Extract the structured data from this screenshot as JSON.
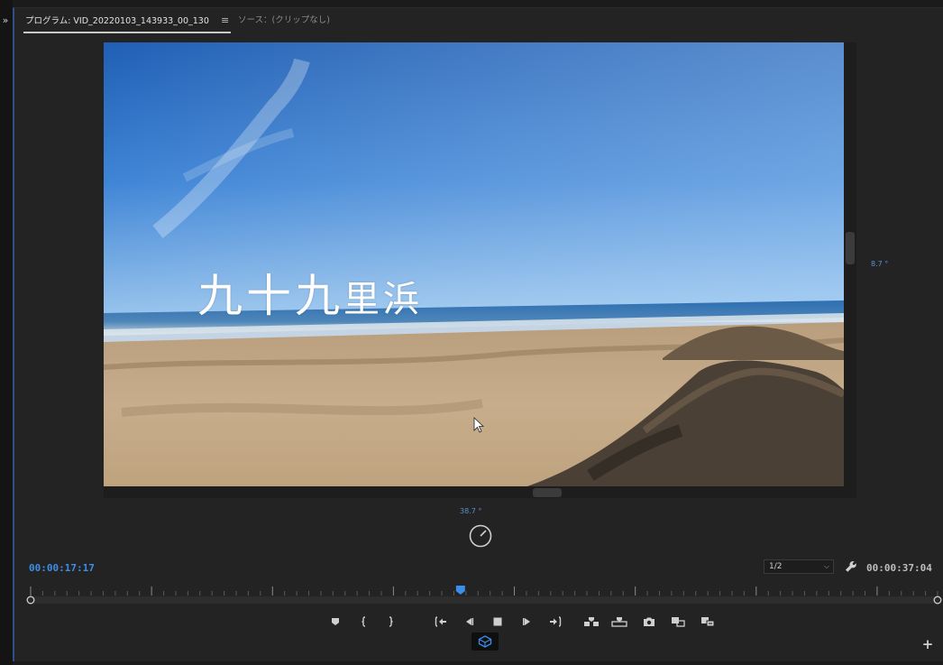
{
  "tabs": {
    "program_label": "プログラム: VID_20220103_143933_00_130",
    "menu_icon": "hamburger-menu-icon",
    "source_label": "ソース：(クリップなし)"
  },
  "monitor": {
    "overlay_title_large": "九十九",
    "overlay_title_small": "里浜",
    "vr_readout_right": "8.7 °",
    "vr_readout_bottom": "38.7 °"
  },
  "controls": {
    "playhead_timecode": "00:00:17:17",
    "zoom_value": "1/2",
    "duration_timecode": "00:00:37:04",
    "playhead_fraction": 0.474
  },
  "transport": {
    "buttons": [
      "add-marker-icon",
      "mark-in-icon",
      "mark-out-icon",
      "go-to-in-icon",
      "step-back-icon",
      "stop-icon",
      "step-forward-icon",
      "go-to-out-icon",
      "insert-icon",
      "overwrite-icon",
      "export-frame-icon",
      "comparison-view-icon",
      "toggle-proxies-icon"
    ]
  },
  "colors": {
    "accent": "#3d8ee8",
    "panel_border": "#2f4f86"
  }
}
